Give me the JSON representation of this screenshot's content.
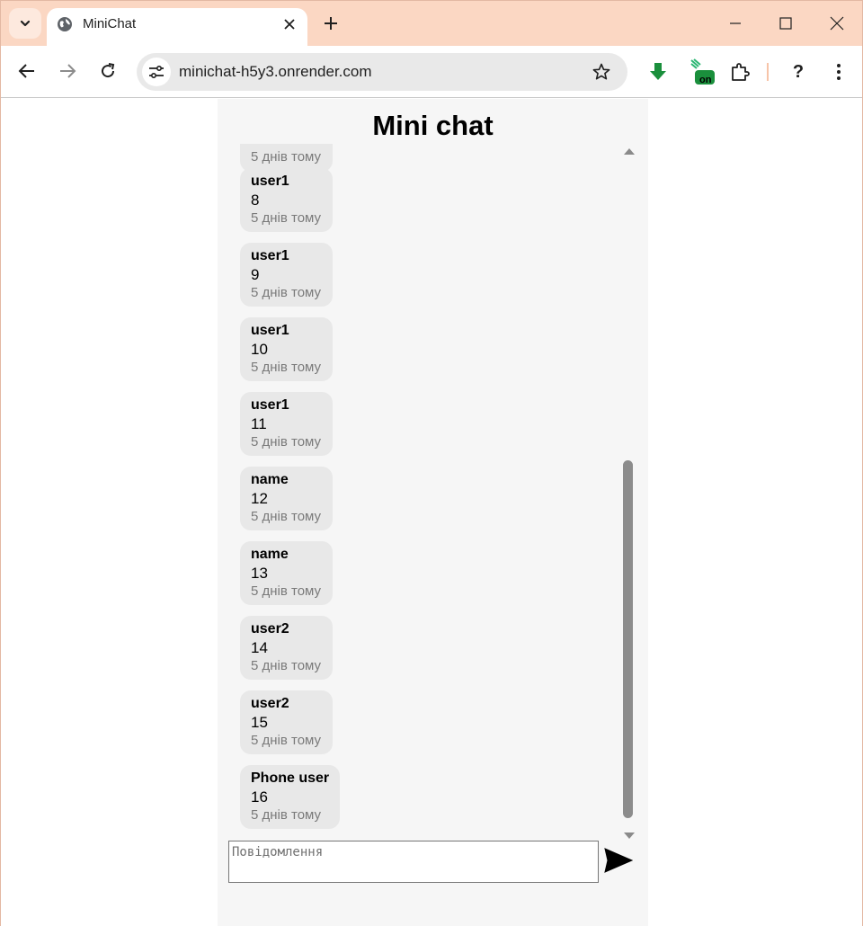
{
  "browser": {
    "tab": {
      "title": "MiniChat"
    },
    "url": "minichat-h5y3.onrender.com",
    "icons": {
      "tab_search": "chevron-down-icon",
      "favicon": "globe-icon",
      "close": "close-icon",
      "new_tab": "plus-icon",
      "minimize": "minimize-icon",
      "maximize": "maximize-icon",
      "close_window": "close-window-icon",
      "back": "back-arrow-icon",
      "forward": "forward-arrow-icon",
      "reload": "reload-icon",
      "site_info": "tune-icon",
      "bookmark": "star-icon",
      "download_ext": "download-arrow-icon",
      "extension_on": "extension-on-icon",
      "extensions": "puzzle-icon",
      "help": "help-icon",
      "menu": "kebab-menu-icon"
    },
    "badge_text": "on",
    "help_label": "?"
  },
  "chat": {
    "title": "Mini chat",
    "top_partial_time": "5 днів тому",
    "messages": [
      {
        "user": "user1",
        "text": "8",
        "time": "5 днів тому"
      },
      {
        "user": "user1",
        "text": "9",
        "time": "5 днів тому"
      },
      {
        "user": "user1",
        "text": "10",
        "time": "5 днів тому"
      },
      {
        "user": "user1",
        "text": "11",
        "time": "5 днів тому"
      },
      {
        "user": "name",
        "text": "12",
        "time": "5 днів тому"
      },
      {
        "user": "name",
        "text": "13",
        "time": "5 днів тому"
      },
      {
        "user": "user2",
        "text": "14",
        "time": "5 днів тому"
      },
      {
        "user": "user2",
        "text": "15",
        "time": "5 днів тому"
      },
      {
        "user": "Phone user",
        "text": "16",
        "time": "5 днів тому"
      }
    ],
    "input": {
      "placeholder": "Повідомлення",
      "value": ""
    },
    "send_icon": "send-icon"
  },
  "colors": {
    "tabstrip": "#fbd7c3",
    "chat_bg": "#f6f6f6",
    "bubble": "#e8e8e8",
    "ext_green": "#1a8f3c"
  }
}
